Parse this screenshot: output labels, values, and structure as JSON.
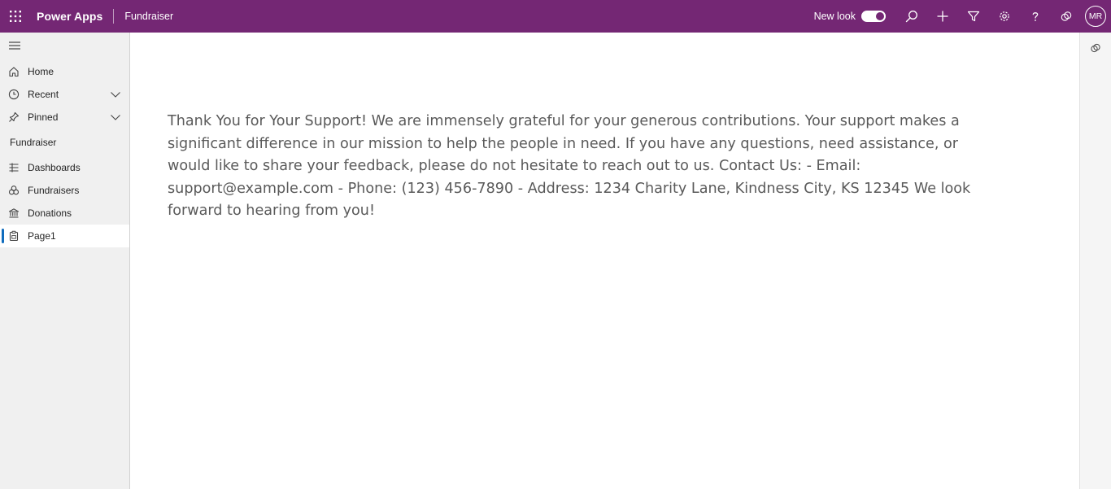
{
  "header": {
    "brand": "Power Apps",
    "app_name": "Fundraiser",
    "new_look_label": "New look",
    "new_look_enabled": true,
    "avatar_initials": "MR",
    "icons": [
      "waffle-icon",
      "search-icon",
      "add-icon",
      "filter-icon",
      "settings-icon",
      "help-icon",
      "copilot-icon"
    ],
    "bar_color": "#742774"
  },
  "sidebar": {
    "items": [
      {
        "label": "Home",
        "icon": "home-icon"
      },
      {
        "label": "Recent",
        "icon": "clock-icon",
        "expandable": true
      },
      {
        "label": "Pinned",
        "icon": "pin-icon",
        "expandable": true
      }
    ],
    "group_label": "Fundraiser",
    "group_items": [
      {
        "label": "Dashboards",
        "icon": "dashboard-icon"
      },
      {
        "label": "Fundraisers",
        "icon": "fundraisers-icon"
      },
      {
        "label": "Donations",
        "icon": "bank-icon"
      },
      {
        "label": "Page1",
        "icon": "page-icon",
        "selected": true
      }
    ],
    "selected_accent": "#0f6cbd"
  },
  "main": {
    "message": "Thank You for Your Support! We are immensely grateful for your generous contributions. Your support makes a significant difference in our mission to help the people in need. If you have any questions, need assistance, or would like to share your feedback, please do not hesitate to reach out to us. Contact Us: - Email: support@example.com - Phone: (123) 456-7890 - Address: 1234 Charity Lane, Kindness City, KS 12345 We look forward to hearing from you!"
  },
  "right_rail": {
    "icon": "copilot-icon"
  }
}
